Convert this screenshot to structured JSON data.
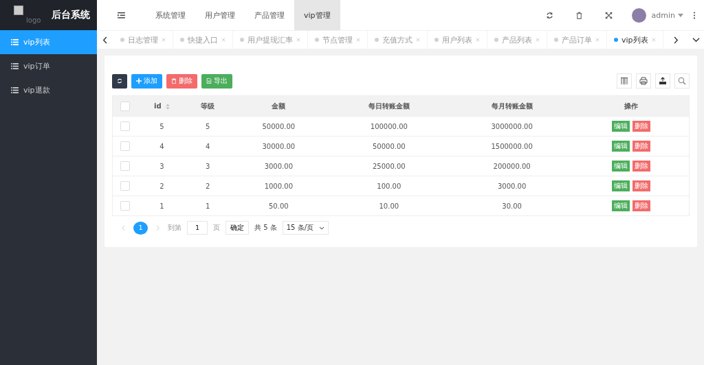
{
  "logo": {
    "alt": "logo",
    "title": "后台系统"
  },
  "sidebar": {
    "items": [
      {
        "label": "vip列表",
        "selected": true
      },
      {
        "label": "vip订单",
        "selected": false
      },
      {
        "label": "vip退款",
        "selected": false
      }
    ]
  },
  "top_nav": {
    "items": [
      {
        "label": "系统管理",
        "selected": false
      },
      {
        "label": "用户管理",
        "selected": false
      },
      {
        "label": "产品管理",
        "selected": false
      },
      {
        "label": "vip管理",
        "selected": true
      }
    ],
    "user": "admin"
  },
  "tabs": [
    {
      "label": "日志管理",
      "selected": false
    },
    {
      "label": "快捷入口",
      "selected": false
    },
    {
      "label": "用户提现汇率",
      "selected": false
    },
    {
      "label": "节点管理",
      "selected": false
    },
    {
      "label": "充值方式",
      "selected": false
    },
    {
      "label": "用户列表",
      "selected": false
    },
    {
      "label": "产品列表",
      "selected": false
    },
    {
      "label": "产品订单",
      "selected": false
    },
    {
      "label": "vip列表",
      "selected": true
    }
  ],
  "toolbar": [
    {
      "kind": "refresh"
    },
    {
      "kind": "add",
      "label": "添加"
    },
    {
      "kind": "delete",
      "label": "删除"
    },
    {
      "kind": "export",
      "label": "导出"
    }
  ],
  "table": {
    "columns": [
      "id",
      "等级",
      "金额",
      "每日转账金额",
      "每月转账金额",
      "操作"
    ],
    "select_all_checked": false,
    "rows": [
      {
        "checked": false,
        "cells": [
          "5",
          "5",
          "50000.00",
          "100000.00",
          "3000000.00"
        ],
        "actions": [
          "编辑",
          "删除"
        ]
      },
      {
        "checked": false,
        "cells": [
          "4",
          "4",
          "30000.00",
          "50000.00",
          "1500000.00"
        ],
        "actions": [
          "编辑",
          "删除"
        ]
      },
      {
        "checked": false,
        "cells": [
          "3",
          "3",
          "3000.00",
          "25000.00",
          "200000.00"
        ],
        "actions": [
          "编辑",
          "删除"
        ]
      },
      {
        "checked": false,
        "cells": [
          "2",
          "2",
          "1000.00",
          "100.00",
          "3000.00"
        ],
        "actions": [
          "编辑",
          "删除"
        ]
      },
      {
        "checked": false,
        "cells": [
          "1",
          "1",
          "50.00",
          "10.00",
          "30.00"
        ],
        "actions": [
          "编辑",
          "删除"
        ]
      }
    ]
  },
  "pagination": {
    "current": "1",
    "goto_label": "到第",
    "goto_value": "1",
    "page_unit": "页",
    "confirm": "确定",
    "total": "共 5 条",
    "page_size": "15 条/页"
  }
}
